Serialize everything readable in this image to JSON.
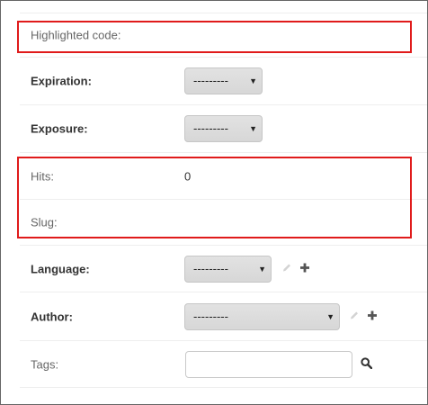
{
  "form": {
    "highlighted_code_label": "Highlighted code:",
    "expiration": {
      "label": "Expiration:",
      "selected": "---------"
    },
    "exposure": {
      "label": "Exposure:",
      "selected": "---------"
    },
    "hits": {
      "label": "Hits:",
      "value": "0"
    },
    "slug": {
      "label": "Slug:",
      "value": ""
    },
    "language": {
      "label": "Language:",
      "selected": "---------"
    },
    "author": {
      "label": "Author:",
      "selected": "---------"
    },
    "tags": {
      "label": "Tags:",
      "value": ""
    }
  },
  "icons": {
    "dropdown": "dropdown-arrow-icon",
    "edit": "pencil-icon",
    "add": "plus-icon",
    "lookup": "magnifier-icon"
  },
  "colors": {
    "highlight_border": "#e01b1b",
    "label_plain": "#666666",
    "label_bold": "#333333",
    "select_bg": "#dcdcdc"
  }
}
